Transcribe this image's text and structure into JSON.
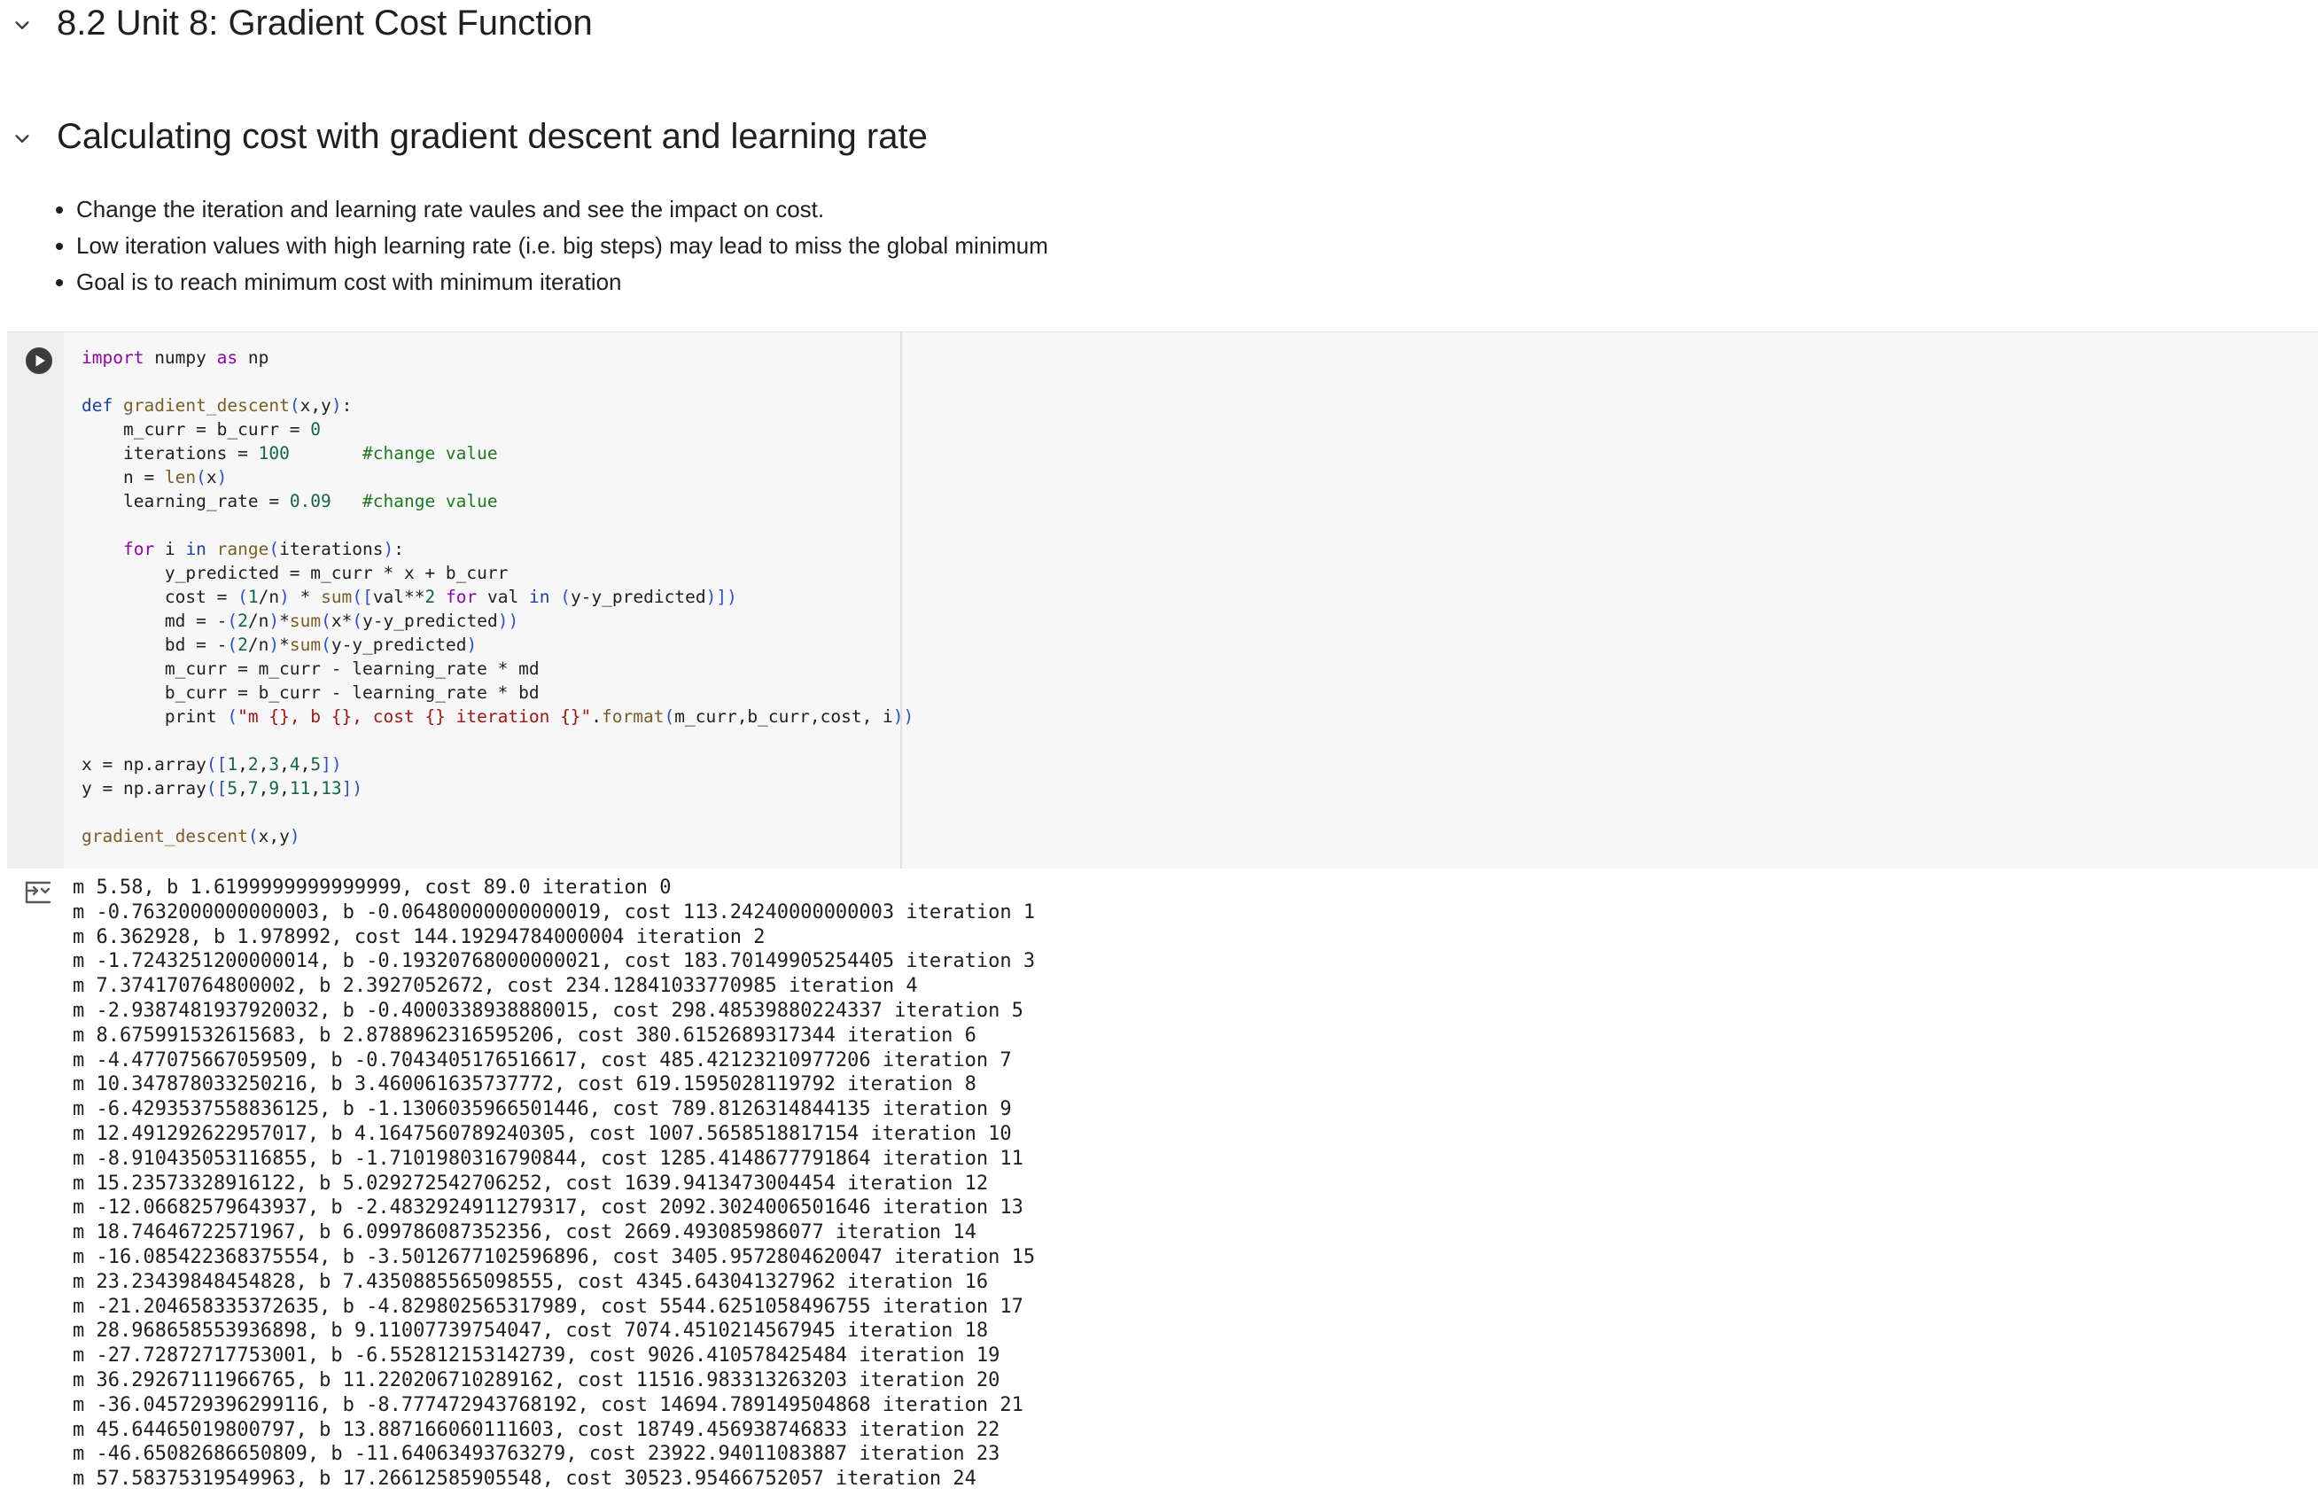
{
  "sections": [
    {
      "title": "8.2 Unit 8: Gradient Cost Function"
    },
    {
      "title": "Calculating cost with gradient descent and learning rate"
    }
  ],
  "bullets": [
    "Change the iteration and learning rate vaules and see the impact on cost.",
    "Low iteration values with high learning rate (i.e. big steps) may lead to miss the global minimum",
    "Goal is to reach minimum cost with minimum iteration"
  ],
  "code_lines": [
    "import numpy as np",
    "",
    "def gradient_descent(x,y):",
    "    m_curr = b_curr = 0",
    "    iterations = 100       #change value",
    "    n = len(x)",
    "    learning_rate = 0.09   #change value",
    "",
    "    for i in range(iterations):",
    "        y_predicted = m_curr * x + b_curr",
    "        cost = (1/n) * sum([val**2 for val in (y-y_predicted)])",
    "        md = -(2/n)*sum(x*(y-y_predicted))",
    "        bd = -(2/n)*sum(y-y_predicted)",
    "        m_curr = m_curr - learning_rate * md",
    "        b_curr = b_curr - learning_rate * bd",
    "        print (\"m {}, b {}, cost {} iteration {}\".format(m_curr,b_curr,cost, i))",
    "",
    "x = np.array([1,2,3,4,5])",
    "y = np.array([5,7,9,11,13])",
    "",
    "gradient_descent(x,y)"
  ],
  "output_lines": [
    "m 5.58, b 1.6199999999999999, cost 89.0 iteration 0",
    "m -0.7632000000000003, b -0.06480000000000019, cost 113.24240000000003 iteration 1",
    "m 6.362928, b 1.978992, cost 144.19294784000004 iteration 2",
    "m -1.7243251200000014, b -0.19320768000000021, cost 183.70149905254405 iteration 3",
    "m 7.374170764800002, b 2.3927052672, cost 234.12841033770985 iteration 4",
    "m -2.9387481937920032, b -0.4000338938880015, cost 298.48539880224337 iteration 5",
    "m 8.675991532615683, b 2.8788962316595206, cost 380.6152689317344 iteration 6",
    "m -4.477075667059509, b -0.7043405176516617, cost 485.42123210977206 iteration 7",
    "m 10.347878033250216, b 3.460061635737772, cost 619.1595028119792 iteration 8",
    "m -6.4293537558836125, b -1.1306035966501446, cost 789.8126314844135 iteration 9",
    "m 12.491292622957017, b 4.1647560789240305, cost 1007.5658518817154 iteration 10",
    "m -8.910435053116855, b -1.7101980316790844, cost 1285.4148677791864 iteration 11",
    "m 15.23573328916122, b 5.029272542706252, cost 1639.9413473004454 iteration 12",
    "m -12.06682579643937, b -2.4832924911279317, cost 2092.3024006501646 iteration 13",
    "m 18.74646722571967, b 6.099786087352356, cost 2669.493085986077 iteration 14",
    "m -16.085422368375554, b -3.5012677102596896, cost 3405.9572804620047 iteration 15",
    "m 23.23439848454828, b 7.4350885565098555, cost 4345.643041327962 iteration 16",
    "m -21.204658335372635, b -4.829802565317989, cost 5544.6251058496755 iteration 17",
    "m 28.968658553936898, b 9.11007739754047, cost 7074.4510214567945 iteration 18",
    "m -27.72872717753001, b -6.552812153142739, cost 9026.410578425484 iteration 19",
    "m 36.29267111966765, b 11.220206710289162, cost 11516.983313263203 iteration 20",
    "m -36.045729396299116, b -8.777472943768192, cost 14694.789149504868 iteration 21",
    "m 45.64465019800797, b 13.887166060111603, cost 18749.456938746833 iteration 22",
    "m -46.65082686650809, b -11.64063493763279, cost 23922.94011083887 iteration 23",
    "m 57.58375319549963, b 17.26612585905548, cost 30523.95466752057 iteration 24"
  ]
}
